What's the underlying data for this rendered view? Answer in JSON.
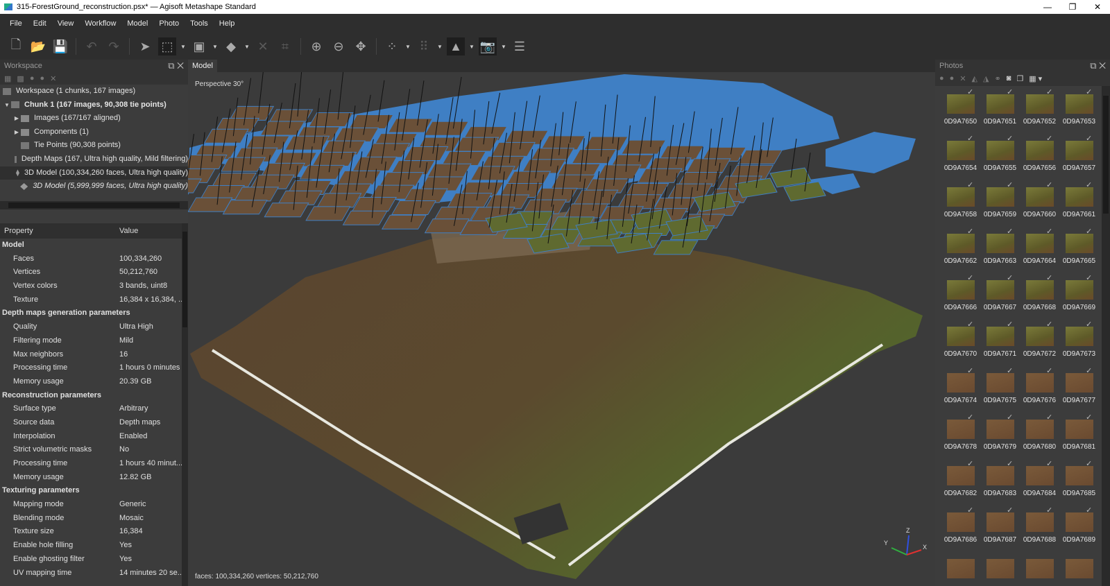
{
  "window": {
    "title": "315-ForestGround_reconstruction.psx* — Agisoft Metashape Standard",
    "min": "—",
    "max": "❐",
    "close": "✕"
  },
  "menu": [
    "File",
    "Edit",
    "View",
    "Workflow",
    "Model",
    "Photo",
    "Tools",
    "Help"
  ],
  "workspace": {
    "title": "Workspace",
    "tree": [
      {
        "label": "Workspace (1 chunks, 167 images)",
        "level": 0,
        "icon": "workspace-icon"
      },
      {
        "label": "Chunk 1 (167 images, 90,308 tie points)",
        "level": 1,
        "icon": "chunk-icon",
        "bold": true
      },
      {
        "label": "Images (167/167 aligned)",
        "level": 2,
        "icon": "folder-icon"
      },
      {
        "label": "Components (1)",
        "level": 2,
        "icon": "folder-icon"
      },
      {
        "label": "Tie Points (90,308 points)",
        "level": 2,
        "icon": "tie-points-icon"
      },
      {
        "label": "Depth Maps (167, Ultra high quality, Mild filtering)",
        "level": 2,
        "icon": "depth-maps-icon"
      },
      {
        "label": "3D Model (100,334,260 faces, Ultra high quality)",
        "level": 2,
        "icon": "model-icon",
        "active": true
      },
      {
        "label": "3D Model (5,999,999 faces, Ultra high quality)",
        "level": 2,
        "icon": "model-icon",
        "italic": true
      }
    ]
  },
  "properties": {
    "header": {
      "property": "Property",
      "value": "Value"
    },
    "rows": [
      {
        "k": "Model",
        "section": true
      },
      {
        "k": "Faces",
        "v": "100,334,260"
      },
      {
        "k": "Vertices",
        "v": "50,212,760"
      },
      {
        "k": "Vertex colors",
        "v": "3 bands, uint8"
      },
      {
        "k": "Texture",
        "v": "16,384 x 16,384, ..."
      },
      {
        "k": "Depth maps generation parameters",
        "section": true
      },
      {
        "k": "Quality",
        "v": "Ultra High"
      },
      {
        "k": "Filtering mode",
        "v": "Mild"
      },
      {
        "k": "Max neighbors",
        "v": "16"
      },
      {
        "k": "Processing time",
        "v": "1 hours 0 minutes"
      },
      {
        "k": "Memory usage",
        "v": "20.39 GB"
      },
      {
        "k": "Reconstruction parameters",
        "section": true
      },
      {
        "k": "Surface type",
        "v": "Arbitrary"
      },
      {
        "k": "Source data",
        "v": "Depth maps"
      },
      {
        "k": "Interpolation",
        "v": "Enabled"
      },
      {
        "k": "Strict volumetric masks",
        "v": "No"
      },
      {
        "k": "Processing time",
        "v": "1 hours 40 minut..."
      },
      {
        "k": "Memory usage",
        "v": "12.82 GB"
      },
      {
        "k": "Texturing parameters",
        "section": true
      },
      {
        "k": "Mapping mode",
        "v": "Generic"
      },
      {
        "k": "Blending mode",
        "v": "Mosaic"
      },
      {
        "k": "Texture size",
        "v": "16,384"
      },
      {
        "k": "Enable hole filling",
        "v": "Yes"
      },
      {
        "k": "Enable ghosting filter",
        "v": "Yes"
      },
      {
        "k": "UV mapping time",
        "v": "14 minutes 20 se..."
      }
    ]
  },
  "view": {
    "tab": "Model",
    "projection": "Perspective 30°",
    "status": "faces: 100,334,260 vertices: 50,212,760",
    "axes": {
      "x": "X",
      "y": "Y",
      "z": "Z"
    }
  },
  "photos": {
    "title": "Photos",
    "items": [
      "0D9A7650",
      "0D9A7651",
      "0D9A7652",
      "0D9A7653",
      "0D9A7654",
      "0D9A7655",
      "0D9A7656",
      "0D9A7657",
      "0D9A7658",
      "0D9A7659",
      "0D9A7660",
      "0D9A7661",
      "0D9A7662",
      "0D9A7663",
      "0D9A7664",
      "0D9A7665",
      "0D9A7666",
      "0D9A7667",
      "0D9A7668",
      "0D9A7669",
      "0D9A7670",
      "0D9A7671",
      "0D9A7672",
      "0D9A7673",
      "0D9A7674",
      "0D9A7675",
      "0D9A7676",
      "0D9A7677",
      "0D9A7678",
      "0D9A7679",
      "0D9A7680",
      "0D9A7681",
      "0D9A7682",
      "0D9A7683",
      "0D9A7684",
      "0D9A7685",
      "0D9A7686",
      "0D9A7687",
      "0D9A7688",
      "0D9A7689"
    ]
  },
  "colors": {
    "camera_plane": "#3f7fc4",
    "ground_brown": "#5a4430",
    "ground_green": "#56602c"
  }
}
